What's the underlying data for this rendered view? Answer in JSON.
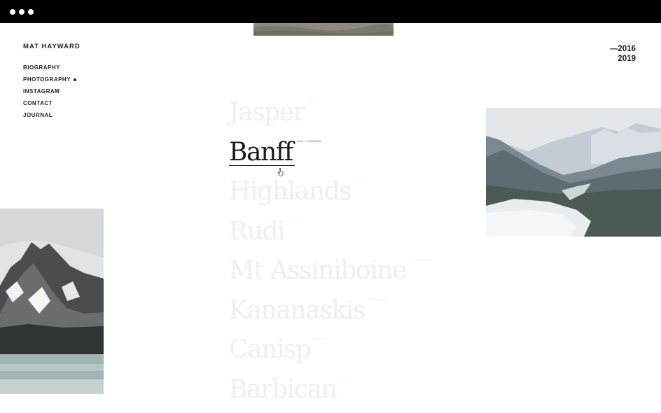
{
  "site": {
    "title": "MAT HAYWARD"
  },
  "nav": {
    "items": [
      {
        "label": "BIOGRAPHY"
      },
      {
        "label": "PHOTOGRAPHY",
        "active": true
      },
      {
        "label": "INSTAGRAM"
      },
      {
        "label": "CONTACT"
      },
      {
        "label": "JOURNAL"
      }
    ]
  },
  "years": {
    "start": "—2016",
    "end": "2019"
  },
  "locations": [
    {
      "name": "Jasper",
      "tag": "alberta"
    },
    {
      "name": "Banff",
      "tag": "ALTA / CANADIAN",
      "active": true
    },
    {
      "name": "Highlands",
      "tag": "scotland"
    },
    {
      "name": "Rudi",
      "tag": "norway"
    },
    {
      "name": "Mt Assiniboine",
      "tag": "british columbia"
    },
    {
      "name": "Kananaskis",
      "tag": "alberta canada"
    },
    {
      "name": "Canisp",
      "tag": "scotland"
    },
    {
      "name": "Barbican",
      "tag": "london"
    }
  ],
  "colors": {
    "chrome": "#000000",
    "text_active": "#1a1a1a",
    "text_faded": "#efefef"
  },
  "icons": {
    "cursor": "hand-pointer-icon",
    "nav_active": "dot-icon"
  }
}
